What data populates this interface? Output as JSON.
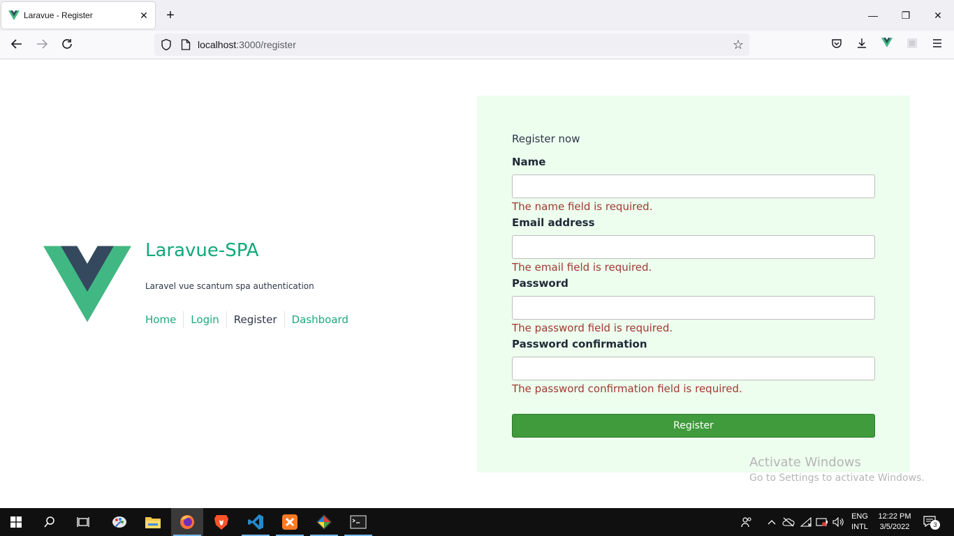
{
  "browser": {
    "tab_title": "Laravue - Register",
    "tab_close": "✕",
    "new_tab": "+",
    "url_host": "localhost",
    "url_rest": ":3000/register",
    "window_min": "—",
    "window_restore": "❐",
    "window_close": "✕"
  },
  "brand": {
    "title": "Laravue-SPA",
    "subtitle": "Laravel vue scantum spa authentication",
    "nav": [
      "Home",
      "Login",
      "Register",
      "Dashboard"
    ]
  },
  "form": {
    "heading": "Register now",
    "fields": [
      {
        "label": "Name",
        "value": "",
        "error": "The name field is required."
      },
      {
        "label": "Email address",
        "value": "",
        "error": "The email field is required."
      },
      {
        "label": "Password",
        "value": "",
        "error": "The password field is required."
      },
      {
        "label": "Password confirmation",
        "value": "",
        "error": "The password confirmation field is required."
      }
    ],
    "submit_label": "Register"
  },
  "watermark": {
    "line1": "Activate Windows",
    "line2": "Go to Settings to activate Windows."
  },
  "taskbar": {
    "lang_top": "ENG",
    "lang_bottom": "INTL",
    "time": "12:22 PM",
    "date": "3/5/2022",
    "notification_count": "3"
  },
  "colors": {
    "brand_green": "#11a87a",
    "vue_dark": "#34495e",
    "vue_green": "#41b883",
    "error_red": "#a13a32",
    "button_green": "#3f9b3c",
    "card_bg": "#edfdee"
  }
}
